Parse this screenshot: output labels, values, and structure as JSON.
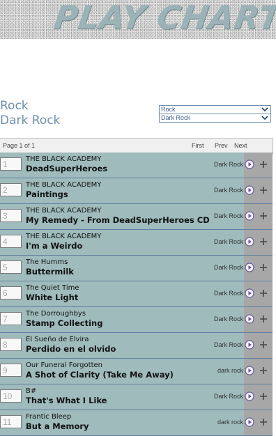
{
  "banner": {
    "title": "PLAY CHARTS"
  },
  "genres": {
    "primary": "Rock",
    "secondary": "Dark Rock"
  },
  "selects": {
    "genre": "Rock",
    "subgenre": "Dark Rock"
  },
  "pager": {
    "page": "Page 1 of 1",
    "first": "First",
    "prev": "Prev",
    "next": "Next"
  },
  "tracks": [
    {
      "rank": "1",
      "artist": "THE BLACK ACADEMY",
      "title": "DeadSuperHeroes",
      "genre": "Dark Rock"
    },
    {
      "rank": "2",
      "artist": "THE BLACK ACADEMY",
      "title": "Paintings",
      "genre": "Dark Rock"
    },
    {
      "rank": "3",
      "artist": "THE BLACK ACADEMY",
      "title": "My Remedy - From DeadSuperHeroes CD",
      "genre": "Dark Rock"
    },
    {
      "rank": "4",
      "artist": "THE BLACK ACADEMY",
      "title": "I'm a Weirdo",
      "genre": "Dark Rock"
    },
    {
      "rank": "5",
      "artist": "The Humms",
      "title": "Buttermilk",
      "genre": "Dark Rock"
    },
    {
      "rank": "6",
      "artist": "The Quiet Time",
      "title": "White Light",
      "genre": "Dark Rock"
    },
    {
      "rank": "7",
      "artist": "The Dorroughbys",
      "title": "Stamp Collecting",
      "genre": "Dark Rock"
    },
    {
      "rank": "8",
      "artist": "El Sueño de Elvira",
      "title": "Perdido en el olvido",
      "genre": "Dark Rock"
    },
    {
      "rank": "9",
      "artist": "Our Funeral Forgotten",
      "title": "A Shot of Clarity (Take Me Away)",
      "genre": "dark rock"
    },
    {
      "rank": "10",
      "artist": "B#",
      "title": "That's What I Like",
      "genre": "Dark Rock"
    },
    {
      "rank": "11",
      "artist": "Frantic Bleep",
      "title": "But a Memory",
      "genre": "dark rock"
    }
  ],
  "icons": {
    "play": "play-icon",
    "add": "plus-icon",
    "dropdown": "chevron-down-icon"
  }
}
